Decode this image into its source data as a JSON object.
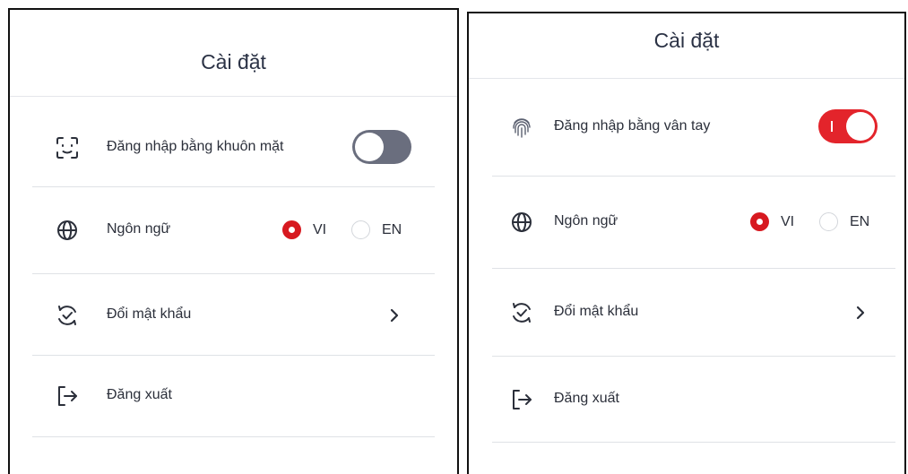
{
  "left": {
    "title": "Cài đặt",
    "face_login": {
      "label": "Đăng nhập bằng khuôn mặt",
      "icon": "face-id-icon",
      "enabled": false
    },
    "language": {
      "label": "Ngôn ngữ",
      "icon": "globe-icon",
      "options": [
        "VI",
        "EN"
      ],
      "selected": "VI"
    },
    "change_password": {
      "label": "Đổi mật khẩu",
      "icon": "password-change-icon"
    },
    "logout": {
      "label": "Đăng xuất",
      "icon": "logout-icon"
    }
  },
  "right": {
    "title": "Cài đặt",
    "fingerprint_login": {
      "label": "Đăng nhập bằng vân tay",
      "icon": "fingerprint-icon",
      "enabled": true
    },
    "language": {
      "label": "Ngôn ngữ",
      "icon": "globe-icon",
      "options": [
        "VI",
        "EN"
      ],
      "selected": "VI"
    },
    "change_password": {
      "label": "Đổi mật khẩu",
      "icon": "password-change-icon"
    },
    "logout": {
      "label": "Đăng xuất",
      "icon": "logout-icon"
    }
  },
  "colors": {
    "accent": "#d71920",
    "toggle_off": "#6a6e7e",
    "text": "#2b2f3a",
    "divider": "#dfe2e6"
  }
}
